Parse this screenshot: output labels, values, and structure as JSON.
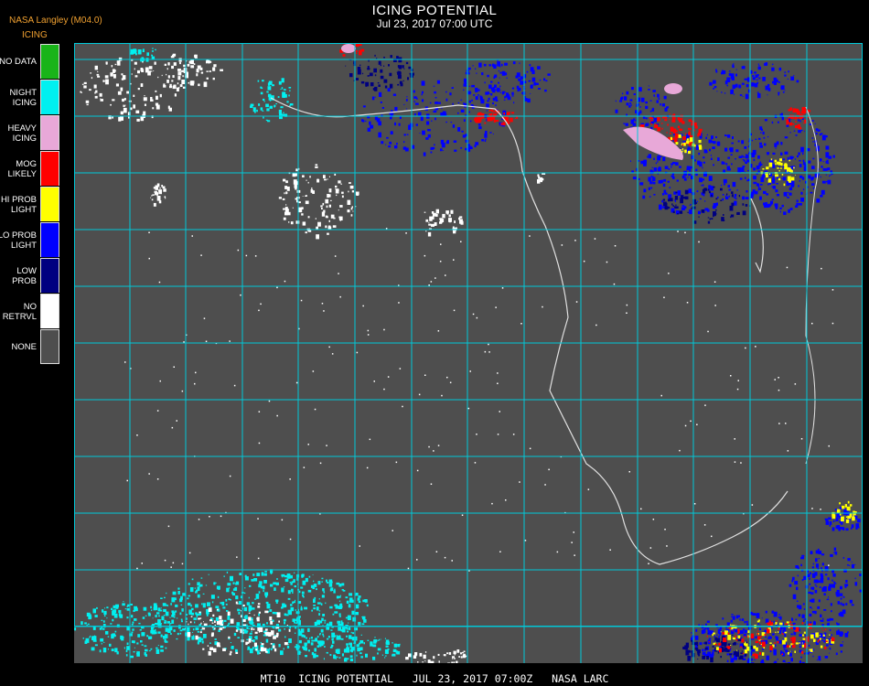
{
  "header": {
    "org": "NASA Langley (M04.0)",
    "product": "ICING",
    "title": "ICING POTENTIAL",
    "subtitle": "Jul 23, 2017 07:00 UTC"
  },
  "legend": [
    {
      "label": "NO DATA",
      "color": "#19b419"
    },
    {
      "label": "NIGHT\nICING",
      "color": "#00f0f0"
    },
    {
      "label": "HEAVY\nICING",
      "color": "#e8a8d8"
    },
    {
      "label": "MOG\nLIKELY",
      "color": "#ff0000"
    },
    {
      "label": "HI PROB\nLIGHT",
      "color": "#ffff00"
    },
    {
      "label": "LO PROB\nLIGHT",
      "color": "#0000ff"
    },
    {
      "label": "LOW\nPROB",
      "color": "#000080"
    },
    {
      "label": "NO\nRETRVL",
      "color": "#ffffff"
    },
    {
      "label": "NONE",
      "color": "#4e4e4e"
    }
  ],
  "map": {
    "grid_color": "#00c8d8",
    "coast_color": "#e0e0e0",
    "label_color": "#d02020",
    "background_color": "#4e4e4e"
  },
  "footer": "MT10  ICING POTENTIAL   JUL 23, 2017 07:00Z   NASA LARC"
}
